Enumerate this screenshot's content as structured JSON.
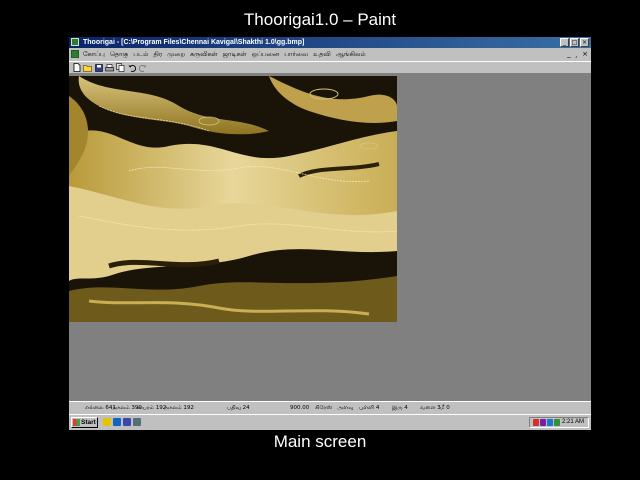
{
  "slide": {
    "caption_top": "Thoorigai1.0  – Paint",
    "caption_bottom": "Main  screen"
  },
  "window": {
    "title": "Thoorigai - [C:\\Program Files\\Chennai Kavigal\\Shakthi 1.0\\gg.bmp]",
    "buttons": [
      "_",
      "□",
      "×"
    ]
  },
  "menu": {
    "items": [
      "கோப்பு",
      "தொகு",
      "படம்",
      "திர",
      "முறை",
      "கருவிகள்",
      "ஜாடிகள்",
      "ஒப்பனை",
      "பார்வை",
      "உதவி",
      "ஆங்கிலம்"
    ],
    "mdi_buttons": [
      "_",
      "¸",
      "×"
    ]
  },
  "toolbar": {
    "tools": [
      {
        "icon": "new-file-icon",
        "color": "#ffffff"
      },
      {
        "icon": "open-folder-icon",
        "color": "#f9d648"
      },
      {
        "icon": "save-icon",
        "color": "#2b3e8c"
      },
      {
        "icon": "print-icon",
        "color": "#9e9e9e"
      },
      {
        "icon": "copy-icon",
        "color": "#e0e0e0"
      },
      {
        "icon": "undo-icon",
        "color": "#000000"
      },
      {
        "icon": "redo-icon",
        "color": "#000000"
      }
    ]
  },
  "status": {
    "fields": [
      "எல்லை 641",
      "அகலம் 399",
      "உயரம் 192",
      "அகலம் 192",
      "பதிவு 24",
      "900.00",
      "கிரேஸ்",
      "அளவு",
      "புள்ளி 4",
      "இரு 4",
      "வளை 3",
      "மீ 0"
    ]
  },
  "taskbar": {
    "start_label": "Start",
    "quick_launch": [
      {
        "icon": "desktop-icon",
        "color": "#e6c200"
      },
      {
        "icon": "ie-icon",
        "color": "#1565c0"
      },
      {
        "icon": "outlook-icon",
        "color": "#3949ab"
      },
      {
        "icon": "channel-icon",
        "color": "#546e7a"
      }
    ],
    "tray_icons": [
      {
        "icon": "language-icon",
        "color": "#d32f2f"
      },
      {
        "icon": "network-icon",
        "color": "#7b1fa2"
      },
      {
        "icon": "volume-icon",
        "color": "#1976d2"
      },
      {
        "icon": "monitor-icon",
        "color": "#388e3c"
      }
    ],
    "clock": "2:21 AM"
  }
}
